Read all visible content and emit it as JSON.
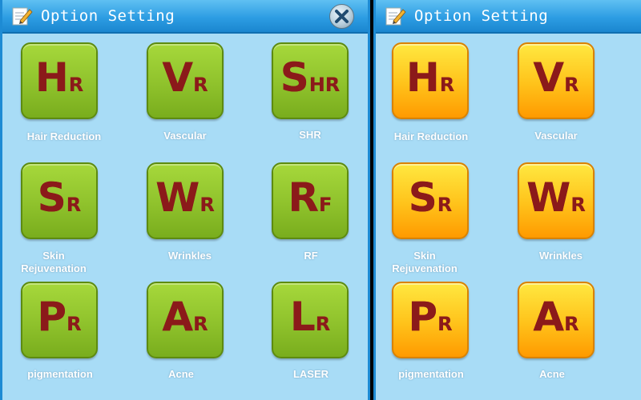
{
  "panels": [
    {
      "title": "Option Setting",
      "theme": "green",
      "tiles": [
        {
          "big": "H",
          "sub": "R",
          "label": "Hair Reduction"
        },
        {
          "big": "V",
          "sub": "R",
          "label": "Vascular"
        },
        {
          "big": "S",
          "sub": "HR",
          "label": "SHR"
        },
        {
          "big": "S",
          "sub": "R",
          "label": "Skin Rejuvenation"
        },
        {
          "big": "W",
          "sub": "R",
          "label": "Wrinkles"
        },
        {
          "big": "R",
          "sub": "F",
          "label": "RF"
        },
        {
          "big": "P",
          "sub": "R",
          "label": "pigmentation"
        },
        {
          "big": "A",
          "sub": "R",
          "label": "Acne"
        },
        {
          "big": "L",
          "sub": "R",
          "label": "LASER"
        }
      ]
    },
    {
      "title": "Option Setting",
      "theme": "orange",
      "tiles": [
        {
          "big": "H",
          "sub": "R",
          "label": "Hair Reduction"
        },
        {
          "big": "V",
          "sub": "R",
          "label": "Vascular"
        },
        {
          "big": "S",
          "sub": "R",
          "label": "Skin Rejuvenation"
        },
        {
          "big": "W",
          "sub": "R",
          "label": "Wrinkles"
        },
        {
          "big": "P",
          "sub": "R",
          "label": "pigmentation"
        },
        {
          "big": "A",
          "sub": "R",
          "label": "Acne"
        }
      ]
    }
  ],
  "icons": {
    "title": "pencil-notepad-icon",
    "close": "close-icon"
  },
  "colors": {
    "panel_bg": "#a8dcf6",
    "titlebar": "#2d9de3",
    "letter": "#8b1a1a",
    "green_tile": "#8fc22c",
    "orange_tile": "#ffc21a"
  }
}
